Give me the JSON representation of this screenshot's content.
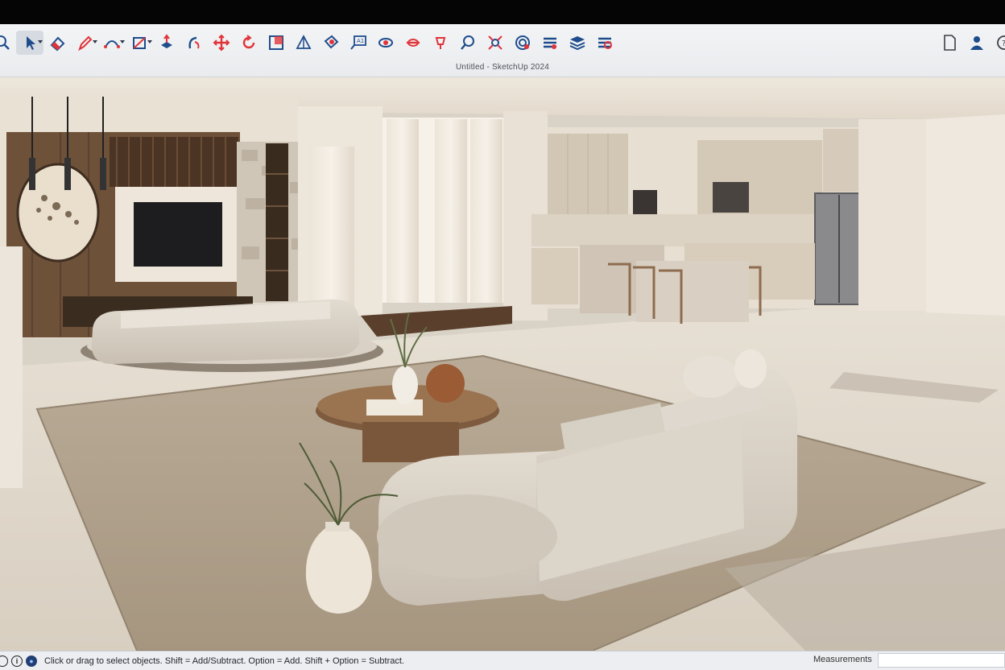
{
  "window": {
    "title": "Untitled - SketchUp 2024"
  },
  "toolbar": {
    "tools": [
      {
        "id": "zoom-search",
        "icon": "magnifier-icon",
        "caret": false
      },
      {
        "id": "select",
        "icon": "arrow-select-icon",
        "caret": true,
        "active": true
      },
      {
        "id": "eraser",
        "icon": "eraser-icon",
        "caret": false
      },
      {
        "id": "pencil",
        "icon": "pencil-icon",
        "caret": true
      },
      {
        "id": "arc",
        "icon": "arc-icon",
        "caret": true
      },
      {
        "id": "shapes",
        "icon": "rectangle-icon",
        "caret": true
      },
      {
        "id": "push-pull",
        "icon": "push-pull-icon",
        "caret": false
      },
      {
        "id": "follow-me",
        "icon": "follow-me-icon",
        "caret": false
      },
      {
        "id": "move",
        "icon": "move-icon",
        "caret": false
      },
      {
        "id": "rotate",
        "icon": "rotate-icon",
        "caret": false
      },
      {
        "id": "scale",
        "icon": "scale-icon",
        "caret": false
      },
      {
        "id": "tape",
        "icon": "tape-measure-icon",
        "caret": false
      },
      {
        "id": "paint",
        "icon": "paint-bucket-icon",
        "caret": false
      },
      {
        "id": "text",
        "icon": "text-label-icon",
        "caret": false
      },
      {
        "id": "orbit",
        "icon": "orbit-icon",
        "caret": false
      },
      {
        "id": "section",
        "icon": "section-plane-icon",
        "caret": false
      },
      {
        "id": "walk",
        "icon": "walk-icon",
        "caret": false
      },
      {
        "id": "zoom",
        "icon": "zoom-icon",
        "caret": false
      },
      {
        "id": "zoom-extents",
        "icon": "zoom-extents-icon",
        "caret": false
      },
      {
        "id": "warehouse",
        "icon": "3d-warehouse-icon",
        "caret": false
      },
      {
        "id": "extension",
        "icon": "extension-icon",
        "caret": false
      },
      {
        "id": "layers",
        "icon": "layers-icon",
        "caret": false
      },
      {
        "id": "solid-tools",
        "icon": "solid-tools-icon",
        "caret": false
      }
    ],
    "right": [
      {
        "id": "document",
        "icon": "document-icon"
      },
      {
        "id": "account",
        "icon": "user-icon"
      },
      {
        "id": "help",
        "icon": "help-icon"
      }
    ],
    "colors": {
      "blue": "#1f4d8c",
      "red": "#e0343a"
    }
  },
  "status": {
    "hint": "Click or drag to select objects. Shift = Add/Subtract. Option = Add. Shift + Option = Subtract.",
    "measurements_label": "Measurements",
    "measurements_value": ""
  }
}
